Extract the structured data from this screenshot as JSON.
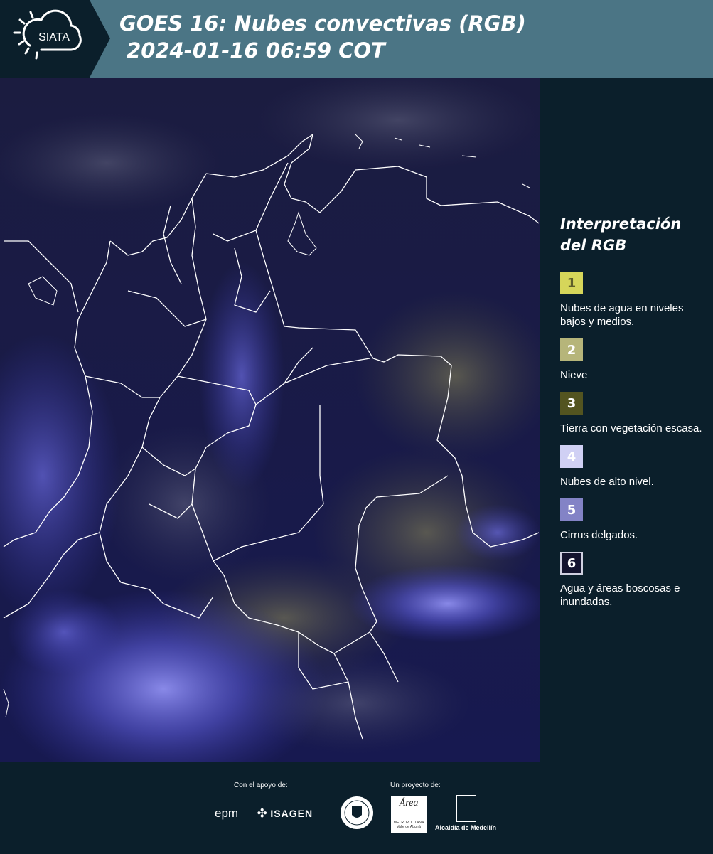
{
  "header": {
    "logo_text": "SIATA",
    "title": "GOES 16: Nubes convectivas (RGB)\n 2024-01-16 06:59 COT"
  },
  "legend": {
    "title": "Interpretación del RGB",
    "items": [
      {
        "number": "1",
        "color": "#d6d65a",
        "text": "Nubes de agua en niveles bajos y medios.",
        "number_color": "#5e5e2a"
      },
      {
        "number": "2",
        "color": "#b6b57a",
        "text": "Nieve",
        "number_color": "#ffffff"
      },
      {
        "number": "3",
        "color": "#535420",
        "text": "Tierra con vegetación escasa.",
        "number_color": "#ffffff"
      },
      {
        "number": "4",
        "color": "#d0d0f4",
        "text": "Nubes de alto nivel.",
        "number_color": "#ffffff"
      },
      {
        "number": "5",
        "color": "#8383c6",
        "text": "Cirrus delgados.",
        "number_color": "#ffffff"
      },
      {
        "number": "6",
        "color": "#13132e",
        "text": "Agua y áreas boscosas e inundadas.",
        "number_color": "#ffffff"
      }
    ]
  },
  "footer": {
    "support_label": "Con el apoyo de:",
    "project_label": "Un proyecto de:",
    "epm": "epm",
    "isagen": "ISAGEN",
    "area_name": "Área",
    "area_sub": "METROPOLITANA Valle de Aburrá",
    "alcaldia": "Alcaldía de Medellín"
  },
  "colors": {
    "header_bg": "#4b7585",
    "page_bg": "#0b1f2b",
    "map_bg": "#15163f"
  }
}
